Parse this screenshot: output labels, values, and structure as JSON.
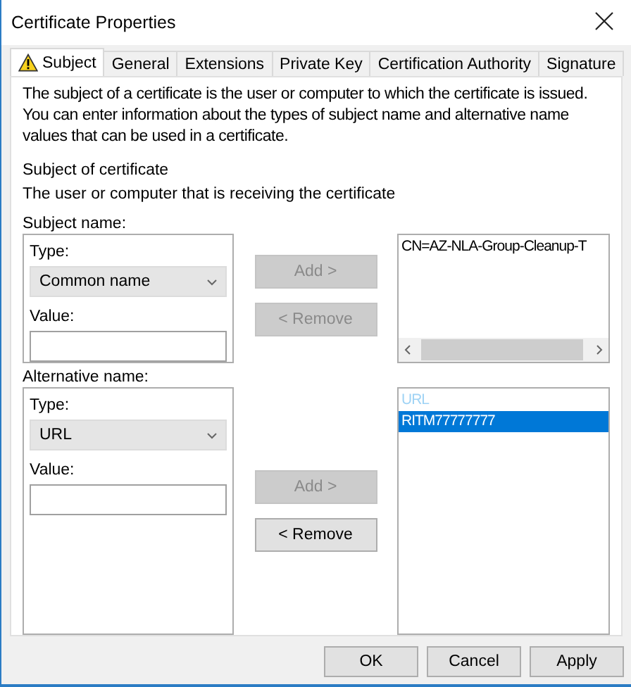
{
  "window": {
    "title": "Certificate Properties"
  },
  "tabs": [
    {
      "label": "Subject",
      "selected": true,
      "warning": true
    },
    {
      "label": "General",
      "selected": false,
      "warning": false
    },
    {
      "label": "Extensions",
      "selected": false,
      "warning": false
    },
    {
      "label": "Private Key",
      "selected": false,
      "warning": false
    },
    {
      "label": "Certification Authority",
      "selected": false,
      "warning": false
    },
    {
      "label": "Signature",
      "selected": false,
      "warning": false
    }
  ],
  "description": "The subject of a certificate is the user or computer to which the certificate is issued. You can enter information about the types of subject name and alternative name values that can be used in a certificate.",
  "section_title": "Subject of certificate",
  "section_subtitle": "The user or computer that is receiving the certificate",
  "groups": [
    {
      "label": "Subject name:",
      "type_label": "Type:",
      "type_value": "Common name",
      "value_label": "Value:",
      "add_button": {
        "label": "Add >",
        "disabled": true
      },
      "remove_button": {
        "label": "< Remove",
        "disabled": true
      },
      "list": {
        "scrollbar": true,
        "items": [
          {
            "text": "CN=AZ-NLA-Group-Cleanup-T",
            "kind": "entry",
            "selected": false
          }
        ]
      }
    },
    {
      "label": "Alternative name:",
      "type_label": "Type:",
      "type_value": "URL",
      "value_label": "Value:",
      "add_button": {
        "label": "Add >",
        "disabled": true
      },
      "remove_button": {
        "label": "< Remove",
        "disabled": false
      },
      "list": {
        "scrollbar": false,
        "items": [
          {
            "text": "URL",
            "kind": "heading",
            "selected": false
          },
          {
            "text": "RITM77777777",
            "kind": "entry",
            "selected": true
          }
        ]
      }
    }
  ],
  "buttons": [
    "OK",
    "Cancel",
    "Apply"
  ]
}
